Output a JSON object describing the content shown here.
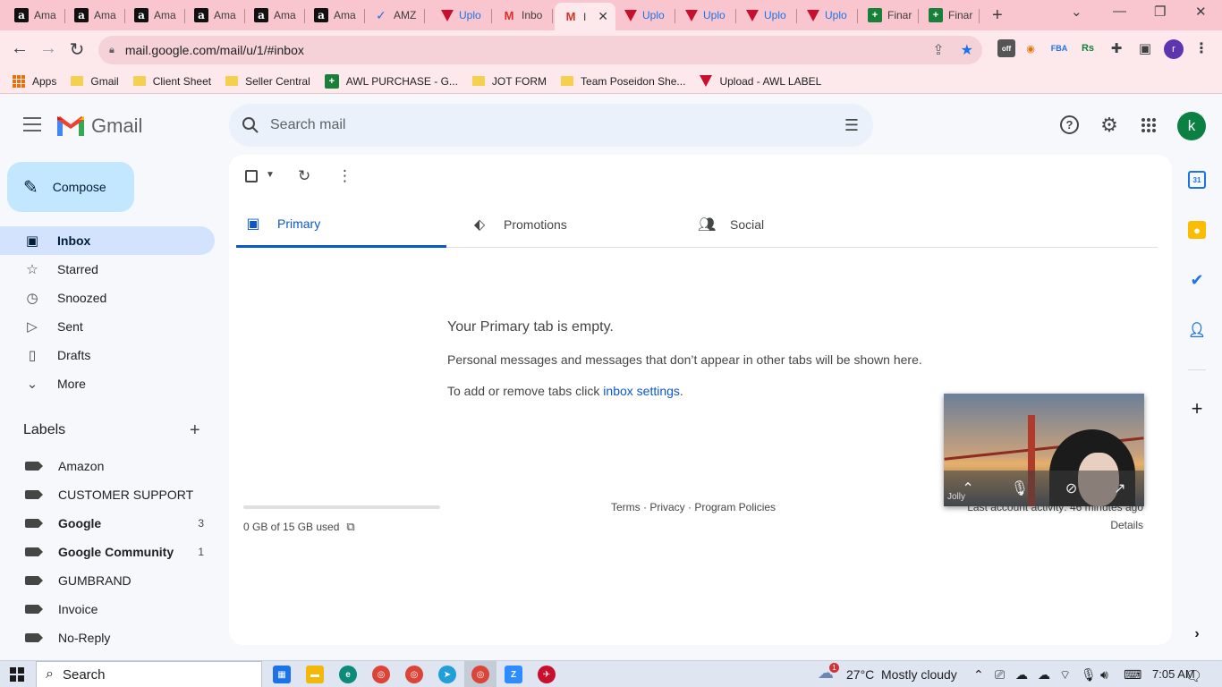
{
  "browser": {
    "tabs": [
      {
        "label": "Ama",
        "favicon": "amazon-icon"
      },
      {
        "label": "Ama",
        "favicon": "amazon-icon"
      },
      {
        "label": "Ama",
        "favicon": "amazon-icon"
      },
      {
        "label": "Ama",
        "favicon": "amazon-icon"
      },
      {
        "label": "Ama",
        "favicon": "amazon-icon"
      },
      {
        "label": "Ama",
        "favicon": "amazon-icon"
      },
      {
        "label": "AMZ",
        "favicon": "amz-prep-icon"
      },
      {
        "label": "Uplo",
        "favicon": "upload-awl-icon"
      },
      {
        "label": "Inbo",
        "favicon": "gmail-icon"
      },
      {
        "label": "I",
        "favicon": "gmail-icon",
        "active": true
      },
      {
        "label": "Uplo",
        "favicon": "upload-awl-icon"
      },
      {
        "label": "Uplo",
        "favicon": "upload-awl-icon"
      },
      {
        "label": "Uplo",
        "favicon": "upload-awl-icon"
      },
      {
        "label": "Uplo",
        "favicon": "upload-awl-icon"
      },
      {
        "label": "Finar",
        "favicon": "sheets-icon"
      },
      {
        "label": "Finar",
        "favicon": "sheets-icon"
      }
    ],
    "url": "mail.google.com/mail/u/1/#inbox",
    "profile_initial": "r",
    "bookmarks": [
      {
        "label": "Apps",
        "icon": "apps-grid-icon"
      },
      {
        "label": "Gmail",
        "icon": "folder-icon"
      },
      {
        "label": "Client Sheet",
        "icon": "folder-icon"
      },
      {
        "label": "Seller Central",
        "icon": "folder-icon"
      },
      {
        "label": "AWL PURCHASE - G...",
        "icon": "sheets-icon"
      },
      {
        "label": "JOT FORM",
        "icon": "folder-icon"
      },
      {
        "label": "Team Poseidon She...",
        "icon": "folder-icon"
      },
      {
        "label": "Upload - AWL LABEL",
        "icon": "upload-awl-icon"
      }
    ]
  },
  "gmail": {
    "app_name": "Gmail",
    "search_placeholder": "Search mail",
    "avatar_initial": "k",
    "compose_label": "Compose",
    "nav": [
      {
        "label": "Inbox",
        "icon": "inbox-icon",
        "active": true
      },
      {
        "label": "Starred",
        "icon": "star-icon"
      },
      {
        "label": "Snoozed",
        "icon": "clock-icon"
      },
      {
        "label": "Sent",
        "icon": "send-icon"
      },
      {
        "label": "Drafts",
        "icon": "draft-icon"
      },
      {
        "label": "More",
        "icon": "chevron-down-icon"
      }
    ],
    "labels_title": "Labels",
    "labels": [
      {
        "label": "Amazon",
        "count": "",
        "bold": false
      },
      {
        "label": "CUSTOMER SUPPORT",
        "count": "",
        "bold": false
      },
      {
        "label": "Google",
        "count": "3",
        "bold": true
      },
      {
        "label": "Google Community",
        "count": "1",
        "bold": true
      },
      {
        "label": "GUMBRAND",
        "count": "",
        "bold": false
      },
      {
        "label": "Invoice",
        "count": "",
        "bold": false
      },
      {
        "label": "No-Reply",
        "count": "",
        "bold": false
      }
    ],
    "tabs": [
      {
        "label": "Primary",
        "icon": "inbox-tab-icon",
        "active": true
      },
      {
        "label": "Promotions",
        "icon": "tag-icon"
      },
      {
        "label": "Social",
        "icon": "people-icon"
      }
    ],
    "empty_title": "Your Primary tab is empty.",
    "empty_subtitle": "Personal messages and messages that don’t appear in other tabs will be shown here.",
    "empty_link_prefix": "To add or remove tabs click ",
    "empty_link_text": "inbox settings",
    "empty_link_suffix": ".",
    "storage_text": "0 GB of 15 GB used",
    "storage_fraction": 0,
    "footer_links": "Terms · Privacy · Program Policies",
    "last_activity": "Last account activity: 46 minutes ago",
    "details_label": "Details"
  },
  "video_overlay": {
    "participant_name": "Jolly"
  },
  "taskbar": {
    "search_label": "Search",
    "weather_temp": "27°C",
    "weather_desc": "Mostly cloudy",
    "weather_badge": "1",
    "time": "7:05 AM"
  },
  "colors": {
    "tabstrip": "#f9c6cf",
    "toolbar": "#fde9ec",
    "gmail_bg": "#f6f8fc",
    "compose": "#c2e7ff",
    "active_nav": "#d3e3fd",
    "primary_blue": "#0b57d0"
  }
}
